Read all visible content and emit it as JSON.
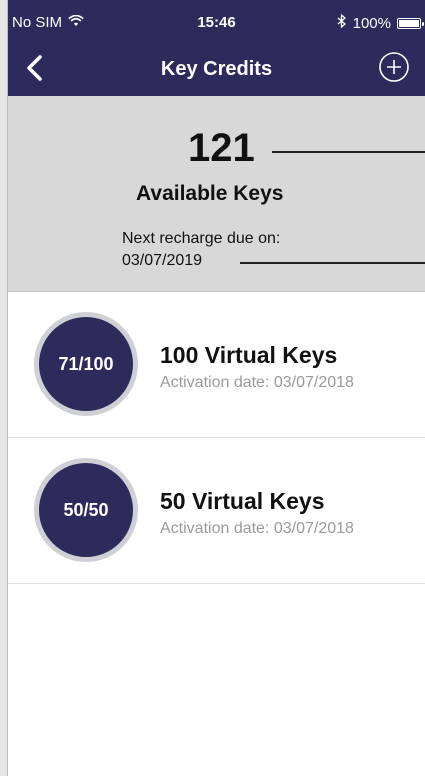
{
  "status": {
    "carrier": "No SIM",
    "time": "15:46",
    "battery": "100%"
  },
  "nav": {
    "title": "Key Credits"
  },
  "summary": {
    "count": "121",
    "label": "Available Keys",
    "recharge_label": "Next recharge due on:",
    "recharge_date": "03/07/2019"
  },
  "items": [
    {
      "badge": "71/100",
      "title": "100 Virtual Keys",
      "activation": "Activation date: 03/07/2018"
    },
    {
      "badge": "50/50",
      "title": "50 Virtual Keys",
      "activation": "Activation date: 03/07/2018"
    }
  ],
  "colors": {
    "primary": "#2d2a5c",
    "summary_bg": "#d9d8d9",
    "secondary_text": "#9a9a9a"
  },
  "icons": {
    "back": "chevron-left-icon",
    "add": "plus-circle-icon",
    "wifi": "wifi-icon",
    "bluetooth": "bluetooth-icon",
    "battery": "battery-icon"
  }
}
